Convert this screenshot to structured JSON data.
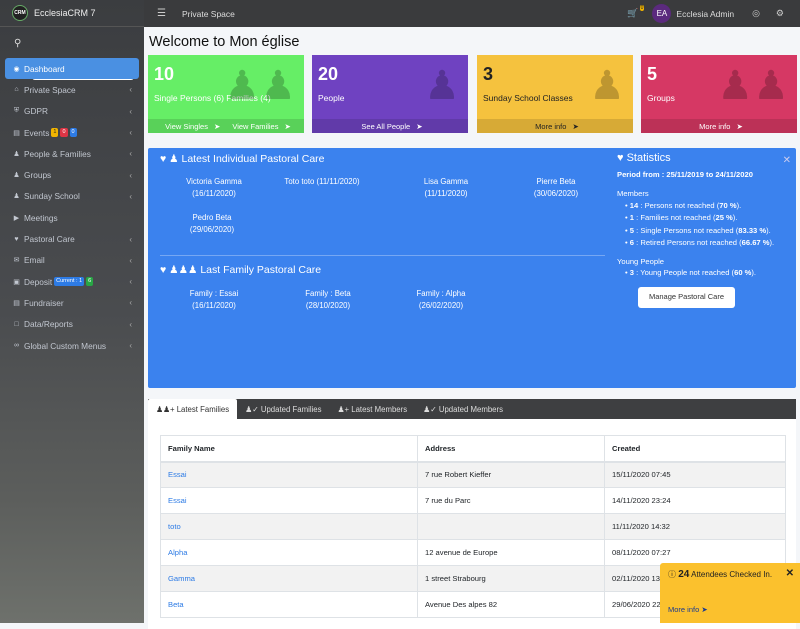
{
  "app": {
    "brand": "EcclesiaCRM 7",
    "logo": "CRM"
  },
  "topbar": {
    "section": "Private Space",
    "cart_count": "0",
    "avatar_initials": "EA",
    "user_name": "Ecclesia Admin"
  },
  "sidebar": {
    "items": [
      {
        "label": "Dashboard",
        "icon": "dashboard-icon"
      },
      {
        "label": "Private Space",
        "icon": "home-icon"
      },
      {
        "label": "GDPR",
        "icon": "shield-icon"
      },
      {
        "label": "Events",
        "icon": "ticket-icon",
        "badges": [
          "1",
          "0",
          "0"
        ]
      },
      {
        "label": "People & Families",
        "icon": "people-icon"
      },
      {
        "label": "Groups",
        "icon": "groups-icon"
      },
      {
        "label": "Sunday School",
        "icon": "child-icon"
      },
      {
        "label": "Meetings",
        "icon": "video-icon"
      },
      {
        "label": "Pastoral Care",
        "icon": "heart-icon"
      },
      {
        "label": "Email",
        "icon": "envelope-icon"
      },
      {
        "label": "Deposit",
        "icon": "bank-icon",
        "badges": [
          "Current : 1",
          "6"
        ]
      },
      {
        "label": "Fundraiser",
        "icon": "money-icon"
      },
      {
        "label": "Data/Reports",
        "icon": "file-icon"
      },
      {
        "label": "Global Custom Menus",
        "icon": "link-icon"
      }
    ]
  },
  "page": {
    "title": "Welcome to Mon église"
  },
  "boxes": [
    {
      "num": "10",
      "label": "Single Persons (6) Families (4)",
      "links": [
        "View Singles",
        "View Families"
      ],
      "color": "#66ee66"
    },
    {
      "num": "20",
      "label": "People",
      "links": [
        "See All People"
      ],
      "color": "#6f42c1"
    },
    {
      "num": "3",
      "label": "Sunday School Classes",
      "links": [
        "More info"
      ],
      "color": "#f5c23e"
    },
    {
      "num": "5",
      "label": "Groups",
      "links": [
        "More info"
      ],
      "color": "#d63864"
    }
  ],
  "pastoral": {
    "individual_title": "Latest Individual Pastoral Care",
    "individual": [
      {
        "name": "Victoria Gamma",
        "date": "(16/11/2020)"
      },
      {
        "name": "Toto toto (11/11/2020)",
        "date": ""
      },
      {
        "name": "Lisa Gamma",
        "date": "(11/11/2020)"
      },
      {
        "name": "Pierre Beta",
        "date": "(30/06/2020)"
      },
      {
        "name": "Pedro Beta",
        "date": "(29/06/2020)"
      }
    ],
    "family_title": "Last Family Pastoral Care",
    "family": [
      {
        "name": "Family : Essai",
        "date": "(16/11/2020)"
      },
      {
        "name": "Family : Beta",
        "date": "(28/10/2020)"
      },
      {
        "name": "Family : Alpha",
        "date": "(26/02/2020)"
      }
    ]
  },
  "stats": {
    "title": "Statistics",
    "period": "Period from : 25/11/2019 to 24/11/2020",
    "members_label": "Members",
    "members": [
      {
        "b": "14",
        "t": " : Persons not reached (",
        "p": "70 %",
        "e": ")."
      },
      {
        "b": "1",
        "t": " : Families not reached (",
        "p": "25 %",
        "e": ")."
      },
      {
        "b": "5",
        "t": " : Single Persons not reached (",
        "p": "83.33 %",
        "e": ")."
      },
      {
        "b": "6",
        "t": " : Retired Persons not reached (",
        "p": "66.67 %",
        "e": ")."
      }
    ],
    "young_label": "Young People",
    "young": [
      {
        "b": "3",
        "t": " : Young People not reached (",
        "p": "60 %",
        "e": ")."
      }
    ],
    "button": "Manage Pastoral Care"
  },
  "tabs": [
    "Latest Families",
    "Updated Families",
    "Latest Members",
    "Updated Members"
  ],
  "table": {
    "headers": [
      "Family Name",
      "Address",
      "Created"
    ],
    "rows": [
      [
        "Essai",
        "7 rue Robert Kieffer",
        "15/11/2020 07:45"
      ],
      [
        "Essai",
        "7 rue du Parc",
        "14/11/2020 23:24"
      ],
      [
        "toto",
        "",
        "11/11/2020 14:32"
      ],
      [
        "Alpha",
        "12 avenue de Europe",
        "08/11/2020 07:27"
      ],
      [
        "Gamma",
        "1 street Strabourg",
        "02/11/2020 13:45"
      ],
      [
        "Beta",
        "Avenue Des alpes 82",
        "29/06/2020 22:16"
      ]
    ]
  },
  "toast": {
    "count": "24",
    "text": "Attendees Checked In.",
    "more": "More info"
  }
}
